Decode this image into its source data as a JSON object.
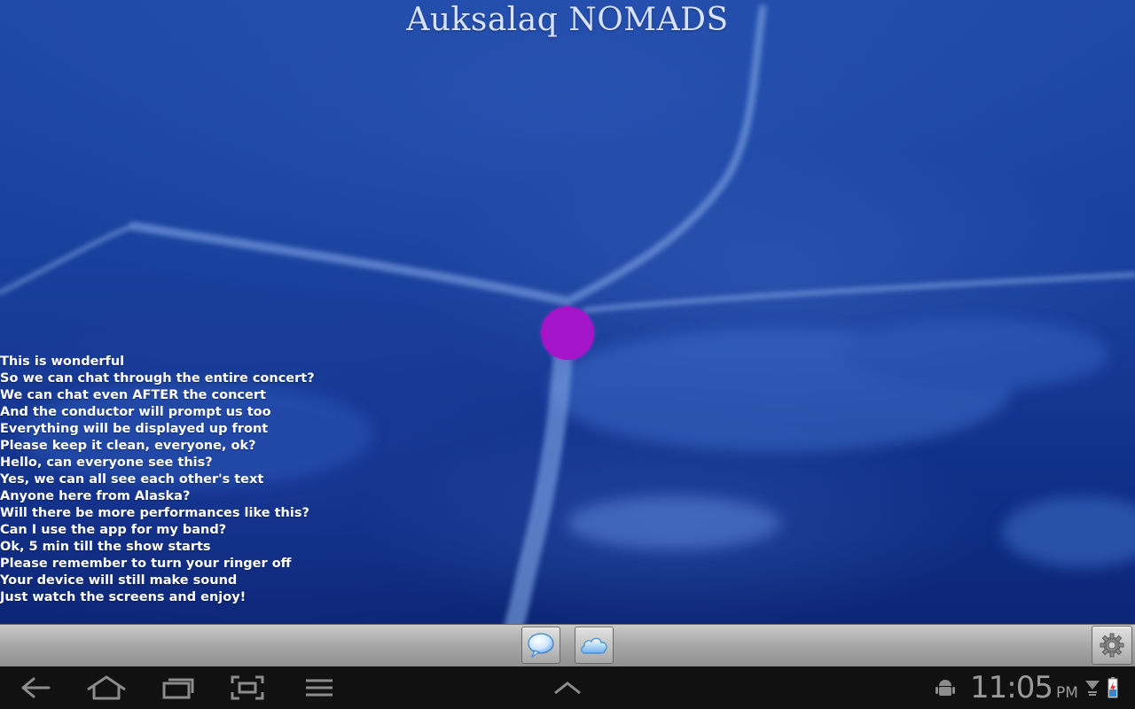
{
  "app": {
    "title": "Auksalaq NOMADS"
  },
  "chat": {
    "messages": [
      "This is wonderful",
      "So we can chat through the entire concert?",
      "We can chat even AFTER the concert",
      "And the conductor will prompt us too",
      "Everything will be displayed up front",
      "Please keep it clean, everyone, ok?",
      "Hello, can everyone see this?",
      "Yes, we can all see each other's text",
      "Anyone here from Alaska?",
      "Will there be more performances like this?",
      "Can I use the app for my band?",
      "Ok, 5 min till the show starts",
      "Please remember to turn your ringer off",
      "Your device will still make sound",
      "Just watch the screens and enjoy!"
    ]
  },
  "toolbar": {
    "chat_icon": "speech-bubble-icon",
    "cloud_icon": "cloud-icon",
    "settings_icon": "gear-icon"
  },
  "status_bar": {
    "time": "11:05",
    "ampm": "PM"
  },
  "colors": {
    "dot": "#a414c8",
    "background": "#163b96",
    "chat_text": "#ffffff"
  }
}
